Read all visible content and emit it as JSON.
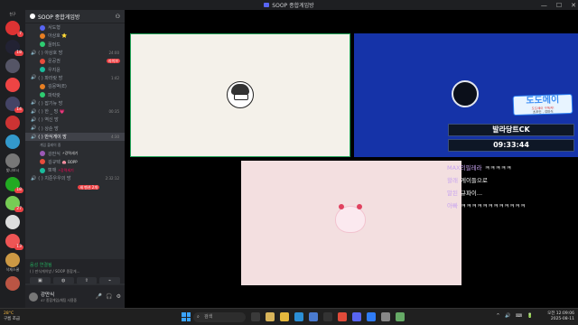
{
  "window": {
    "title": "SOOP 종합게임방",
    "controls": [
      "—",
      "☐",
      "✕"
    ]
  },
  "rail": {
    "top_label": "친구",
    "servers": [
      {
        "badge": "7"
      },
      {
        "badge": "18"
      },
      {
        "badge": ""
      },
      {
        "badge": ""
      },
      {
        "badge": "14"
      },
      {
        "badge": ""
      },
      {
        "badge": ""
      },
      {
        "badge": ""
      },
      {
        "badge": "18"
      },
      {
        "badge": "27"
      },
      {
        "badge": ""
      },
      {
        "badge": "13"
      },
      {
        "badge": ""
      },
      {
        "badge": ""
      }
    ],
    "labels": [
      "빛나보시",
      "삭제스쿨"
    ]
  },
  "sidebar": {
    "server_name": "SOOP 종합게임방",
    "rows": [
      {
        "kind": "user",
        "text": "서도형",
        "time": "",
        "live": ""
      },
      {
        "kind": "user",
        "text": "아상호 ⭐",
        "time": "",
        "live": ""
      },
      {
        "kind": "user",
        "text": "꿀머드",
        "time": "",
        "live": ""
      },
      {
        "kind": "channel",
        "text": "( ) 아상호 방",
        "time": "24:00",
        "live": ""
      },
      {
        "kind": "user",
        "text": "운공권",
        "time": "",
        "live": "라이브"
      },
      {
        "kind": "user",
        "text": "우지윤",
        "time": "",
        "live": ""
      },
      {
        "kind": "channel",
        "text": "( ) 파라랏 방",
        "time": "1:42",
        "live": ""
      },
      {
        "kind": "user",
        "text": "김뭉벅(E)",
        "time": "",
        "live": ""
      },
      {
        "kind": "user",
        "text": "파락랏",
        "time": "",
        "live": ""
      },
      {
        "kind": "channel",
        "text": "( ) 잡기뉴 방",
        "time": "",
        "live": ""
      },
      {
        "kind": "channel",
        "text": "( ) 한 _ 빙 💗",
        "time": "00:35",
        "live": ""
      },
      {
        "kind": "channel",
        "text": "( ) 역신 방",
        "time": "",
        "live": ""
      },
      {
        "kind": "channel",
        "text": "( ) 상순 방",
        "time": "",
        "live": ""
      },
      {
        "kind": "channel",
        "text": "( ) 만식게이 방",
        "time": "4:30",
        "live": "",
        "selected": true
      },
      {
        "kind": "sub",
        "text": "게임 플레이 중",
        "time": "",
        "live": ""
      },
      {
        "kind": "user",
        "text": "강만식",
        "time": "",
        "live": "",
        "tag": "⚡강력세기"
      },
      {
        "kind": "user",
        "text": "김규텍",
        "time": "",
        "live": "",
        "tag": "🐽 BOPP"
      },
      {
        "kind": "user",
        "text": "뽀깨",
        "time": "",
        "live": "",
        "tag": "⚡강력세기",
        "tagred": true
      },
      {
        "kind": "channel",
        "text": "( ) 치준우우의 방",
        "time": "2:32:12",
        "live": ""
      },
      {
        "kind": "user",
        "text": "",
        "time": "",
        "live": "새 멘션 2개"
      }
    ]
  },
  "voice_panel": {
    "status": "음성 연결됨",
    "detail": "( ) 만식게이방 / SOOP 종합게...",
    "buttons": [
      "▣",
      "◍",
      "⇪",
      "⌁"
    ]
  },
  "user_panel": {
    "name": "강만식",
    "status": "47 종합게임/채팅 사용중",
    "controls": [
      "🎤",
      "🎧",
      "⚙"
    ]
  },
  "overlay": {
    "brand_main": "도도메이",
    "brand_sub": "도도메이 구독자!",
    "brand_small": "초초인 , 강만식",
    "name_box": "발라당트CK",
    "clock_box": "09:33:44"
  },
  "chat": [
    {
      "nick": "MAX의필레라",
      "text": "ㅋㅋㅋㅋㅋ"
    },
    {
      "nick": "할래",
      "text": "게이들으로"
    },
    {
      "nick": "말된",
      "text": "규파이..."
    },
    {
      "nick": "아빠",
      "text": "ㅋㅋㅋㅋㅋㅋㅋㅋㅋㅋㅋㅋ"
    }
  ],
  "taskbar": {
    "weather_temp": "28°C",
    "weather_desc": "구름 조금",
    "search_placeholder": "검색",
    "tray_time": "오전 12:09:06",
    "tray_date": "2025-08-11",
    "tray_icons": "^ 🔊 ⌨ 🔋"
  }
}
